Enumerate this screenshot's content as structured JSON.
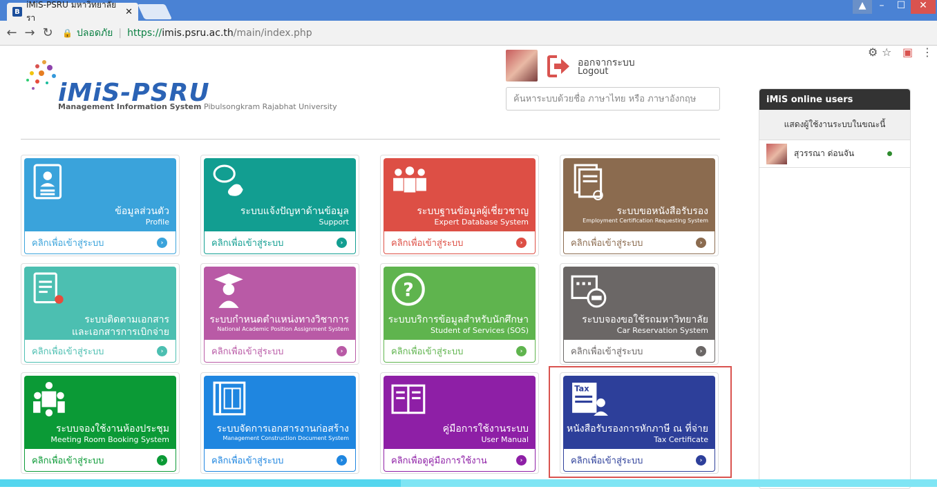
{
  "browser": {
    "tab_title": "iMiS-PSRU มหาวิทยาลัยรา",
    "tab_favicon": "B",
    "secure_label": "ปลอดภัย",
    "url_scheme": "https://",
    "url_host": "imis.psru.ac.th",
    "url_path": "/main/index.php"
  },
  "header": {
    "logo_name": "iMiS-PSRU",
    "logo_tag_bold": "Management Information System",
    "logo_tag": "Pibulsongkram Rajabhat University",
    "logout_th": "ออกจากระบบ",
    "logout_en": "Logout",
    "search_placeholder": "ค้นหาระบบด้วยชื่อ ภาษาไทย หรือ ภาษาอังกฤษ"
  },
  "cards": [
    {
      "th": "ข้อมูลส่วนตัว",
      "en": "Profile",
      "foot": "คลิกเพื่อเข้าสู่ระบบ",
      "color": "#3aa3db",
      "icon": "profile-card-icon"
    },
    {
      "th": "ระบบแจ้งปัญหาด้านข้อมูล",
      "en": "Support",
      "foot": "คลิกเพื่อเข้าสู่ระบบ",
      "color": "#129e91",
      "icon": "support-phone-icon"
    },
    {
      "th": "ระบบฐานข้อมูลผู้เชี่ยวชาญ",
      "en": "Expert Database System",
      "foot": "คลิกเพื่อเข้าสู่ระบบ",
      "color": "#dd4f45",
      "icon": "experts-group-icon"
    },
    {
      "th": "ระบบขอหนังสือรับรอง",
      "en": "Employment Certification Requesting System",
      "foot": "คลิกเพื่อเข้าสู่ระบบ",
      "color": "#8b6b4f",
      "icon": "certificate-doc-icon"
    },
    {
      "th1": "ระบบติดตามเอกสาร",
      "th2": "และเอกสารการเบิกจ่าย",
      "foot": "คลิกเพื่อเข้าสู่ระบบ",
      "color": "#4cbfb1",
      "icon": "document-location-icon"
    },
    {
      "th": "ระบบกำหนดตำแหน่งทางวิชาการ",
      "en": "National Academic Position Assignment System",
      "foot": "คลิกเพื่อเข้าสู่ระบบ",
      "color": "#b95aa6",
      "icon": "graduate-icon"
    },
    {
      "th": "ระบบบริการข้อมูลสำหรับนักศึกษา",
      "en": "Student of Services (SOS)",
      "foot": "คลิกเพื่อเข้าสู่ระบบ",
      "color": "#5fb44e",
      "icon": "question-circle-icon"
    },
    {
      "th": "ระบบจองขอใช้รถมหาวิทยาลัย",
      "en": "Car Reservation System",
      "foot": "คลิกเพื่อเข้าสู่ระบบ",
      "color": "#6b6766",
      "icon": "calendar-car-icon"
    },
    {
      "th": "ระบบจองใช้งานห้องประชุม",
      "en": "Meeting Room Booking System",
      "foot": "คลิกเพื่อเข้าสู่ระบบ",
      "color": "#0b9a36",
      "icon": "meeting-room-icon"
    },
    {
      "th": "ระบบจัดการเอกสารงานก่อสร้าง",
      "en": "Management Construction Document System",
      "foot": "คลิกเพื่อเข้าสู่ระบบ",
      "color": "#1f86e0",
      "icon": "blueprint-icon"
    },
    {
      "th": "คู่มือการใช้งานระบบ",
      "en": "User Manual",
      "foot": "คลิกเพื่อดูคู่มือการใช้งาน",
      "color": "#8e1fa6",
      "icon": "open-book-icon"
    },
    {
      "th": "หนังสือรับรองการหักภาษี ณ ที่จ่าย",
      "en": "Tax Certificate",
      "foot": "คลิกเพื่อเข้าสู่ระบบ",
      "color": "#2d3f9a",
      "icon": "tax-document-icon"
    }
  ],
  "sidebar": {
    "title": "iMiS online users",
    "subtitle": "แสดงผู้ใช้งานระบบในขณะนี้",
    "users": [
      {
        "name": "สุวรรณา ด่อนจัน"
      }
    ]
  }
}
